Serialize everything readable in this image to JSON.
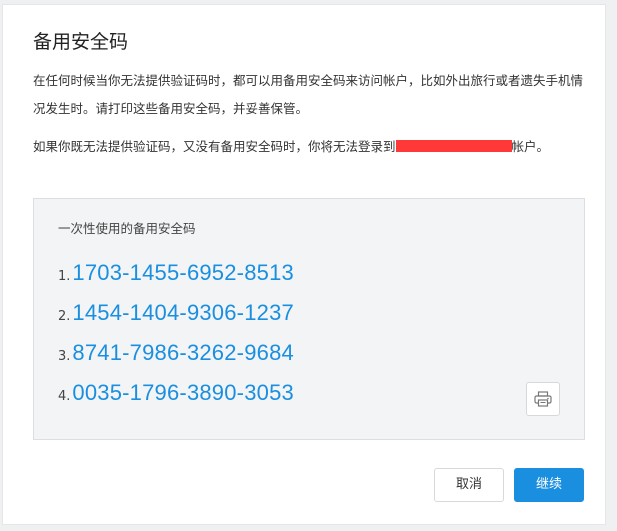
{
  "dialog": {
    "title": "备用安全码",
    "paragraph1": "在任何时候当你无法提供验证码时，都可以用备用安全码来访问帐户，比如外出旅行或者遗失手机情况发生时。请打印这些备用安全码，并妥善保管。",
    "paragraph2_before": "如果你既无法提供验证码，又没有备用安全码时，你将无法登录到",
    "paragraph2_after": "帐户。",
    "redaction_color": "#ff3838"
  },
  "codes": {
    "label": "一次性使用的备用安全码",
    "items": [
      {
        "num": "1.",
        "code": "1703-1455-6952-8513"
      },
      {
        "num": "2.",
        "code": "1454-1404-9306-1237"
      },
      {
        "num": "3.",
        "code": "8741-7986-3262-9684"
      },
      {
        "num": "4.",
        "code": "0035-1796-3890-3053"
      }
    ],
    "print_icon": "printer-icon"
  },
  "buttons": {
    "cancel": "取消",
    "continue": "继续"
  },
  "colors": {
    "accent": "#1a8fe0",
    "code_text": "#1a8fe0"
  }
}
